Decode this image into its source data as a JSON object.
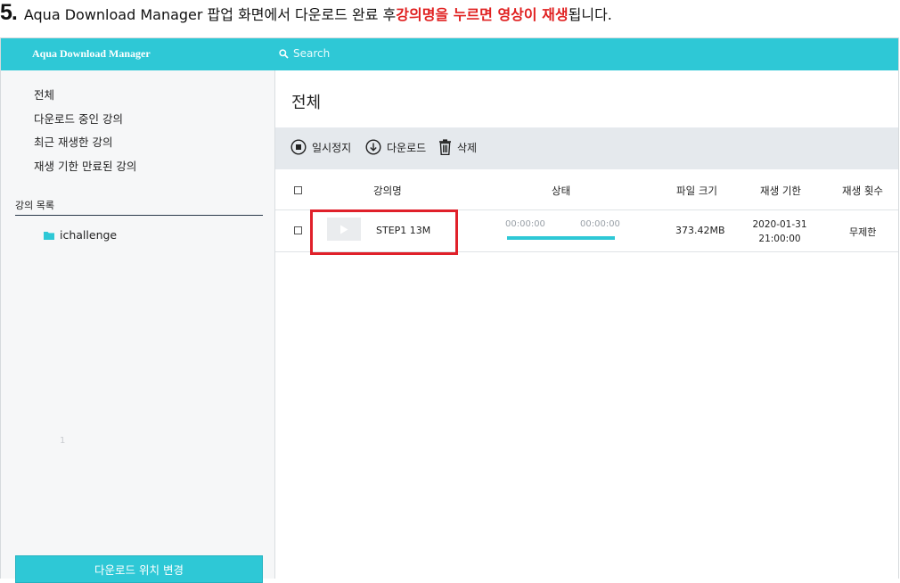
{
  "instruction": {
    "number": "5.",
    "text_before": "Aqua Download Manager 팝업 화면에서 다운로드 완료 후 ",
    "text_highlight": "강의명을 누르면 영상이 재생",
    "text_after": "됩니다."
  },
  "app": {
    "title": "Aqua Download Manager",
    "search_placeholder": "Search"
  },
  "sidebar": {
    "nav_items": [
      {
        "label": "전체"
      },
      {
        "label": "다운로드 중인 강의"
      },
      {
        "label": "최근 재생한 강의"
      },
      {
        "label": "재생 기한 만료된 강의"
      }
    ],
    "section_title": "강의 목록",
    "folder_label": "ichallenge",
    "faint_mark": "1",
    "change_location_label": "다운로드 위치 변경"
  },
  "main": {
    "page_title": "전체",
    "toolbar": {
      "pause_label": "일시정지",
      "download_label": "다운로드",
      "delete_label": "삭제"
    },
    "columns": [
      "강의명",
      "상태",
      "파일 크기",
      "재생 기한",
      "재생 횟수"
    ],
    "rows": [
      {
        "course_name": "STEP1 13M",
        "time_start": "00:00:00",
        "time_end": "00:00:00",
        "progress_percent": 100,
        "file_size": "373.42MB",
        "expiry_date": "2020-01-31",
        "expiry_time": "21:00:00",
        "play_count": "무제한"
      }
    ]
  },
  "colors": {
    "accent": "#2ec8d6",
    "highlight": "#e0202a",
    "toolbar_bg": "#e5e9ed",
    "sidebar_bg": "#f6f7f8"
  },
  "icons": {
    "search": "search-icon",
    "folder": "folder-icon",
    "pause": "pause-circle-icon",
    "download": "download-circle-icon",
    "delete": "trash-icon",
    "play": "play-icon"
  }
}
